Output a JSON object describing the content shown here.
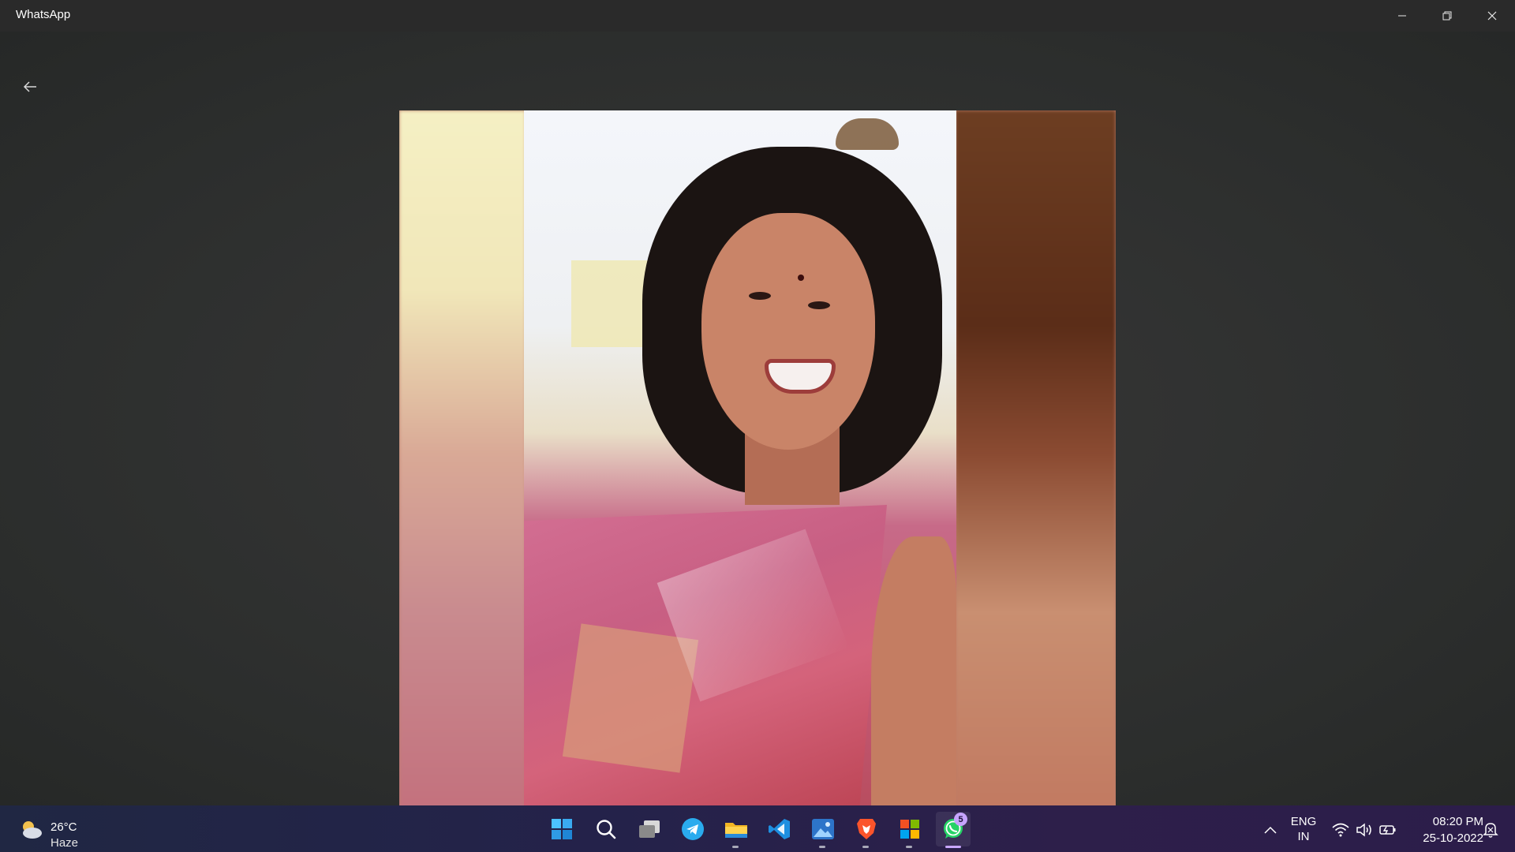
{
  "window": {
    "title": "WhatsApp",
    "controls": {
      "minimize_icon": "minimize-icon",
      "restore_icon": "restore-icon",
      "close_icon": "close-icon"
    }
  },
  "viewer": {
    "back_icon": "arrow-left-icon"
  },
  "taskbar": {
    "weather": {
      "temperature": "26°C",
      "condition": "Haze",
      "icon": "weather-partly-cloudy-icon"
    },
    "apps": [
      {
        "name": "Start",
        "icon": "windows-start-icon"
      },
      {
        "name": "Search",
        "icon": "search-icon"
      },
      {
        "name": "Task View",
        "icon": "task-view-icon"
      },
      {
        "name": "Telegram",
        "icon": "telegram-icon"
      },
      {
        "name": "File Explorer",
        "icon": "folder-icon",
        "running": true
      },
      {
        "name": "Visual Studio Code",
        "icon": "vscode-icon"
      },
      {
        "name": "Photos",
        "icon": "photos-icon",
        "running": true
      },
      {
        "name": "Brave",
        "icon": "brave-icon",
        "running": true
      },
      {
        "name": "Microsoft Store",
        "icon": "store-icon",
        "running": true
      },
      {
        "name": "WhatsApp",
        "icon": "whatsapp-icon",
        "running": true,
        "active": true,
        "badge": "5"
      }
    ],
    "tray": {
      "language_line1": "ENG",
      "language_line2": "IN",
      "time": "08:20 PM",
      "date": "25-10-2022"
    }
  },
  "colors": {
    "whatsapp_green": "#25D366",
    "telegram_blue": "#2AABEE",
    "vscode_blue": "#1E8FE0",
    "brave_orange": "#FB542B",
    "badge_purple": "#C6A4FF"
  }
}
